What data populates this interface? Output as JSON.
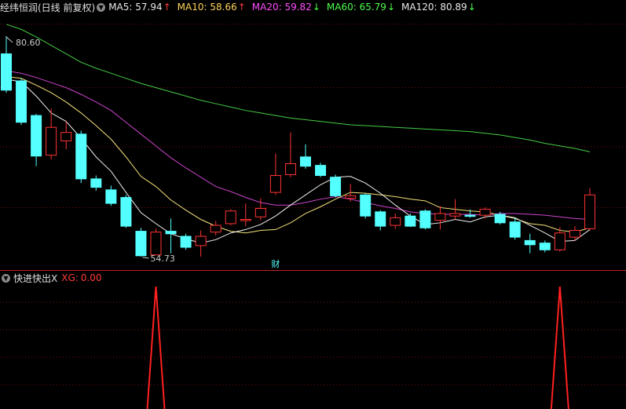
{
  "main_panel": {
    "title": "经纬恒润(日线 前复权)",
    "dropdown_icon": "chevron-down-icon",
    "indicators": [
      {
        "label": "MA5",
        "value": "57.94",
        "arrow": "↑",
        "color": "#e8e8e8",
        "arrow_color": "#ff3b3b"
      },
      {
        "label": "MA10",
        "value": "58.66",
        "arrow": "↑",
        "color": "#ffd35a",
        "arrow_color": "#ff3b3b"
      },
      {
        "label": "MA20",
        "value": "59.82",
        "arrow": "↓",
        "color": "#ff4cff",
        "arrow_color": "#4cff4c"
      },
      {
        "label": "MA60",
        "value": "65.79",
        "arrow": "↓",
        "color": "#4cff4c",
        "arrow_color": "#4cff4c"
      },
      {
        "label": "MA120",
        "value": "80.89",
        "arrow": "↓",
        "color": "#e8e8e8",
        "arrow_color": "#4cff4c"
      }
    ],
    "high_label": "80.60",
    "low_label": "54.73",
    "event_marker": "财"
  },
  "sub_panel": {
    "title": "快进快出X",
    "indicator_label": "XG:",
    "indicator_value": "0.00",
    "dropdown_icon": "chevron-down-icon"
  },
  "colors": {
    "up": "#ff3333",
    "down": "#54ffff",
    "ma5": "#f0f0f0",
    "ma10": "#f5e37a",
    "ma20": "#cc44cc",
    "ma60": "#44cc44",
    "grid": "#7a1010",
    "text": "#cccccc"
  },
  "candles": [
    {
      "o": 78.5,
      "c": 74.2,
      "h": 80.6,
      "l": 73.9
    },
    {
      "o": 75.3,
      "c": 70.4,
      "h": 75.6,
      "l": 70.1
    },
    {
      "o": 71.2,
      "c": 66.4,
      "h": 71.4,
      "l": 65.2
    },
    {
      "o": 66.5,
      "c": 69.8,
      "h": 72.0,
      "l": 66.0
    },
    {
      "o": 68.2,
      "c": 69.2,
      "h": 70.5,
      "l": 67.2
    },
    {
      "o": 69.0,
      "c": 63.7,
      "h": 69.4,
      "l": 63.2
    },
    {
      "o": 63.7,
      "c": 62.7,
      "h": 64.1,
      "l": 62.3
    },
    {
      "o": 62.4,
      "c": 60.8,
      "h": 62.9,
      "l": 60.5
    },
    {
      "o": 61.5,
      "c": 58.1,
      "h": 61.8,
      "l": 57.9
    },
    {
      "o": 57.5,
      "c": 54.6,
      "h": 57.9,
      "l": 54.5
    },
    {
      "o": 54.7,
      "c": 57.4,
      "h": 57.8,
      "l": 54.7
    },
    {
      "o": 57.5,
      "c": 57.2,
      "h": 59.0,
      "l": 54.9
    },
    {
      "o": 56.9,
      "c": 55.6,
      "h": 57.2,
      "l": 55.3
    },
    {
      "o": 55.8,
      "c": 56.9,
      "h": 57.6,
      "l": 54.5
    },
    {
      "o": 57.4,
      "c": 58.2,
      "h": 58.7,
      "l": 57.0
    },
    {
      "o": 58.4,
      "c": 59.9,
      "h": 60.1,
      "l": 58.2
    },
    {
      "o": 58.8,
      "c": 58.9,
      "h": 60.8,
      "l": 58.1
    },
    {
      "o": 59.2,
      "c": 60.2,
      "h": 61.4,
      "l": 58.8
    },
    {
      "o": 62.1,
      "c": 64.1,
      "h": 66.7,
      "l": 61.8
    },
    {
      "o": 64.2,
      "c": 65.5,
      "h": 69.2,
      "l": 63.9
    },
    {
      "o": 66.3,
      "c": 65.2,
      "h": 67.8,
      "l": 64.9
    },
    {
      "o": 65.3,
      "c": 64.1,
      "h": 65.6,
      "l": 63.9
    },
    {
      "o": 63.9,
      "c": 61.7,
      "h": 64.2,
      "l": 61.5
    },
    {
      "o": 61.4,
      "c": 61.7,
      "h": 63.1,
      "l": 61.0
    },
    {
      "o": 61.8,
      "c": 59.3,
      "h": 62.0,
      "l": 59.0
    },
    {
      "o": 59.8,
      "c": 58.1,
      "h": 60.0,
      "l": 57.6
    },
    {
      "o": 58.2,
      "c": 59.1,
      "h": 59.6,
      "l": 57.8
    },
    {
      "o": 59.3,
      "c": 58.1,
      "h": 59.6,
      "l": 58.0
    },
    {
      "o": 59.9,
      "c": 57.9,
      "h": 60.1,
      "l": 57.7
    },
    {
      "o": 58.8,
      "c": 59.6,
      "h": 60.5,
      "l": 57.7
    },
    {
      "o": 59.3,
      "c": 59.6,
      "h": 61.3,
      "l": 58.9
    },
    {
      "o": 59.4,
      "c": 59.3,
      "h": 60.1,
      "l": 59.1
    },
    {
      "o": 59.4,
      "c": 60.1,
      "h": 60.3,
      "l": 59.0
    },
    {
      "o": 59.5,
      "c": 58.5,
      "h": 59.8,
      "l": 58.3
    },
    {
      "o": 58.6,
      "c": 56.8,
      "h": 59.1,
      "l": 56.5
    },
    {
      "o": 56.4,
      "c": 55.9,
      "h": 57.2,
      "l": 54.9
    },
    {
      "o": 56.1,
      "c": 55.3,
      "h": 56.4,
      "l": 55.0
    },
    {
      "o": 55.3,
      "c": 57.3,
      "h": 58.0,
      "l": 55.1
    },
    {
      "o": 56.8,
      "c": 57.6,
      "h": 58.1,
      "l": 56.4
    },
    {
      "o": 57.8,
      "c": 61.8,
      "h": 62.6,
      "l": 57.6
    }
  ],
  "ma_lines": {
    "ma5": [
      75.5,
      75.2,
      73.5,
      71.5,
      70.5,
      68.5,
      66.3,
      64.6,
      62.1,
      59.7,
      58.4,
      57.2,
      56.6,
      56.1,
      56.5,
      57.3,
      57.7,
      58.3,
      59.3,
      60.6,
      61.8,
      63.0,
      63.9,
      64.0,
      63.2,
      62.0,
      60.6,
      59.3,
      58.3,
      58.5,
      58.9,
      58.6,
      59.2,
      59.4,
      59.1,
      58.2,
      57.3,
      56.3,
      56.4,
      57.7
    ],
    "ma10": [
      75.8,
      75.6,
      74.8,
      73.9,
      72.8,
      71.5,
      70.0,
      68.4,
      66.3,
      64.0,
      62.8,
      61.2,
      60.0,
      58.9,
      58.1,
      57.5,
      57.3,
      57.6,
      57.7,
      58.5,
      59.6,
      60.4,
      61.3,
      62.1,
      62.0,
      61.8,
      61.6,
      61.3,
      61.1,
      60.3,
      60.1,
      59.9,
      59.8,
      59.4,
      59.0,
      58.4,
      58.2,
      57.6,
      57.4,
      57.9
    ],
    "ma20": [
      76.5,
      76.2,
      75.7,
      75.1,
      74.5,
      73.7,
      72.8,
      71.8,
      70.4,
      69.0,
      67.6,
      66.2,
      65.0,
      63.9,
      62.8,
      62.2,
      61.5,
      60.9,
      60.6,
      60.6,
      60.9,
      61.3,
      61.6,
      61.3,
      60.9,
      60.5,
      60.2,
      59.8,
      59.6,
      59.5,
      59.5,
      59.5,
      59.4,
      59.6,
      59.6,
      59.5,
      59.4,
      59.2,
      59.0,
      58.9
    ],
    "ma60": [
      82.0,
      81.4,
      80.5,
      79.5,
      78.5,
      77.5,
      76.8,
      76.2,
      75.6,
      75.0,
      74.5,
      74.0,
      73.5,
      73.0,
      72.6,
      72.2,
      71.8,
      71.5,
      71.2,
      70.9,
      70.7,
      70.5,
      70.3,
      70.1,
      70.0,
      69.9,
      69.8,
      69.7,
      69.6,
      69.5,
      69.4,
      69.3,
      69.1,
      68.9,
      68.6,
      68.3,
      67.9,
      67.6,
      67.3,
      66.9
    ]
  },
  "xg_signals": [
    10,
    37
  ]
}
